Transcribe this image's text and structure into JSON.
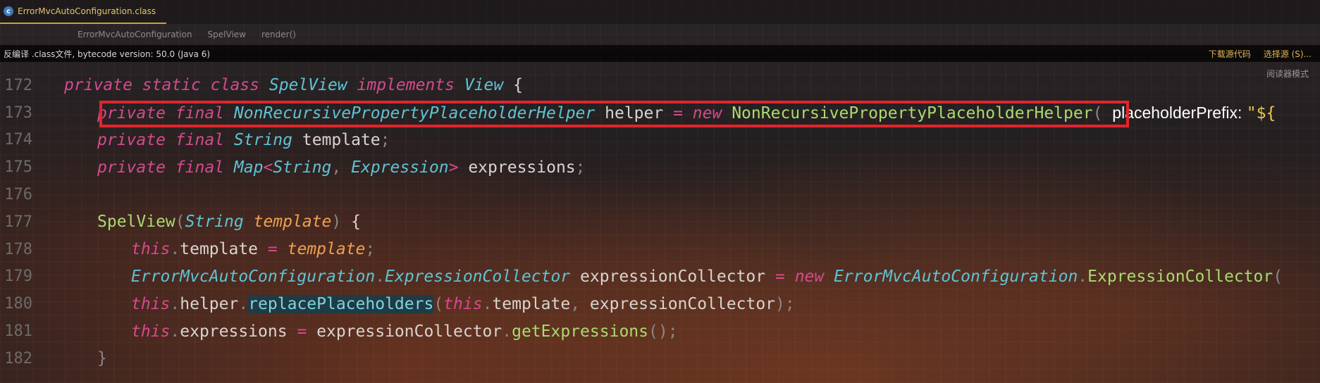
{
  "tab": {
    "icon": "class-file-icon",
    "title": "ErrorMvcAutoConfiguration.class"
  },
  "breadcrumb": [
    "ErrorMvcAutoConfiguration",
    "SpelView",
    "render()"
  ],
  "infobar": {
    "message": "反编译 .class文件, bytecode version: 50.0 (Java 6)",
    "download": "下载源代码",
    "choose": "选择源 (S)..."
  },
  "reader_mode": "阅读器模式",
  "lines": {
    "n172": "172",
    "n173": "173",
    "n174": "174",
    "n175": "175",
    "n176": "176",
    "n177": "177",
    "n178": "178",
    "n179": "179",
    "n180": "180",
    "n181": "181",
    "n182": "182"
  },
  "code": {
    "kw_private": "private",
    "kw_static": "static",
    "kw_class": "class",
    "kw_final": "final",
    "kw_implements": "implements",
    "kw_new": "new",
    "kw_this": "this",
    "cls_spelview": "SpelView",
    "ty_view": "View",
    "ty_nrph": "NonRecursivePropertyPlaceholderHelper",
    "id_helper": "helper",
    "fn_nrph": "NonRecursivePropertyPlaceholderHelper",
    "hint_prefix": "placeholderPrefix: ",
    "str_prefix": "\"${",
    "ty_string": "String",
    "id_template": "template",
    "ty_map": "Map",
    "ty_expression": "Expression",
    "id_expressions": "expressions",
    "fn_spelview": "SpelView",
    "pm_template": "template",
    "ty_emac": "ErrorMvcAutoConfiguration",
    "ty_collector": "ExpressionCollector",
    "id_collector": "expressionCollector",
    "fn_collector": "ExpressionCollector",
    "fn_replace": "replacePlaceholders",
    "fn_getexpr": "getExpressions",
    "brace_open": "{",
    "brace_close": "}"
  }
}
